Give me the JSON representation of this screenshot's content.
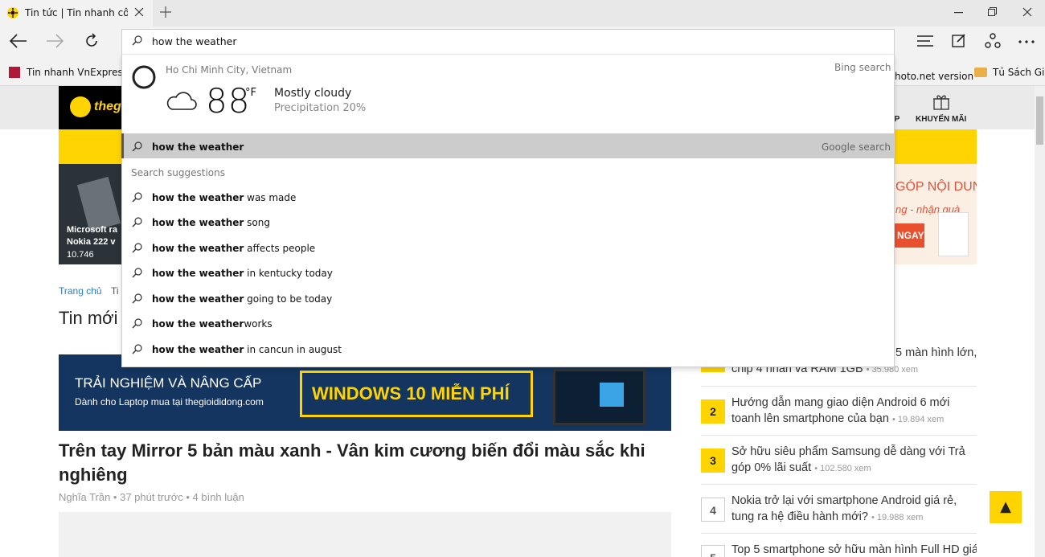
{
  "browser": {
    "tab_title": "Tin tức | Tin nhanh công",
    "address_value": "how the weather",
    "favorites": [
      "Tin nhanh VnExpress",
      "hoto.net version",
      "Tủ Sách Giải"
    ]
  },
  "weather": {
    "location": "Ho Chi Minh City, Vietnam",
    "temperature": "88",
    "unit": "°F",
    "condition": "Mostly cloudy",
    "precipitation": "Precipitation 20%",
    "source": "Bing search"
  },
  "top_result": {
    "text": "how the weather",
    "source": "Google search"
  },
  "suggestions": {
    "heading": "Search suggestions",
    "items": [
      {
        "bold": "how the weather",
        "rest": " was made"
      },
      {
        "bold": "how the weather",
        "rest": " song"
      },
      {
        "bold": "how the weather",
        "rest": " affects people"
      },
      {
        "bold": "how the weather",
        "rest": " in kentucky today"
      },
      {
        "bold": "how the weather",
        "rest": " going to be today"
      },
      {
        "bold": "how the weather",
        "rest": "works"
      },
      {
        "bold": "how the weather",
        "rest": " in cancun in august"
      }
    ]
  },
  "page": {
    "logo_text": "theg",
    "header_menu_left": "PP",
    "header_menu_promo": "KHUYẾN MÃI",
    "promo_left_lines": [
      "Microsoft ra",
      "Nokia 222 v",
      "10.746"
    ],
    "promo_right_lines": [
      "GÓP NỘI DUNG",
      "ng - nhận quà",
      "NGAY"
    ],
    "breadcrumb_home": "Trang chủ",
    "breadcrumb_next": "Ti",
    "section_title": "Tin mới",
    "banner_line1": "TRẢI NGHIỆM VÀ NÂNG CẤP",
    "banner_line2": "Dành cho Laptop mua tại thegioididong.com",
    "banner_cta": "WINDOWS 10 MIỄN PHÍ",
    "article_title": "Trên tay Mirror 5 bản màu xanh - Vân kim cương biến đổi màu sắc khi nghiêng",
    "article_meta": "Nghĩa Trần • 37 phút trước • 4 bình luận",
    "side_items": [
      {
        "num": "1",
        "text": "chip 4 nhân và RAM 1GB",
        "prefix": "5 màn hình lớn,",
        "views": "• 35.980 xem"
      },
      {
        "num": "2",
        "text": "Hướng dẫn mang giao diện Android 6 mới toanh lên smartphone của bạn",
        "views": "• 19.894 xem"
      },
      {
        "num": "3",
        "text": "Sở hữu siêu phẩm Samsung dễ dàng với Trả góp 0% lãi suất",
        "views": "• 102.580 xem"
      },
      {
        "num": "4",
        "text": "Nokia trở lại với smartphone Android giá rẻ, tung ra hệ điều hành mới?",
        "views": "• 19.988 xem"
      },
      {
        "num": "5",
        "text": "Top 5 smartphone sở hữu màn hình Full HD giá",
        "views": ""
      }
    ],
    "back_to_top": "▲"
  },
  "colors": {
    "accent_yellow": "#ffd400",
    "highlight_row": "#cccccc"
  }
}
